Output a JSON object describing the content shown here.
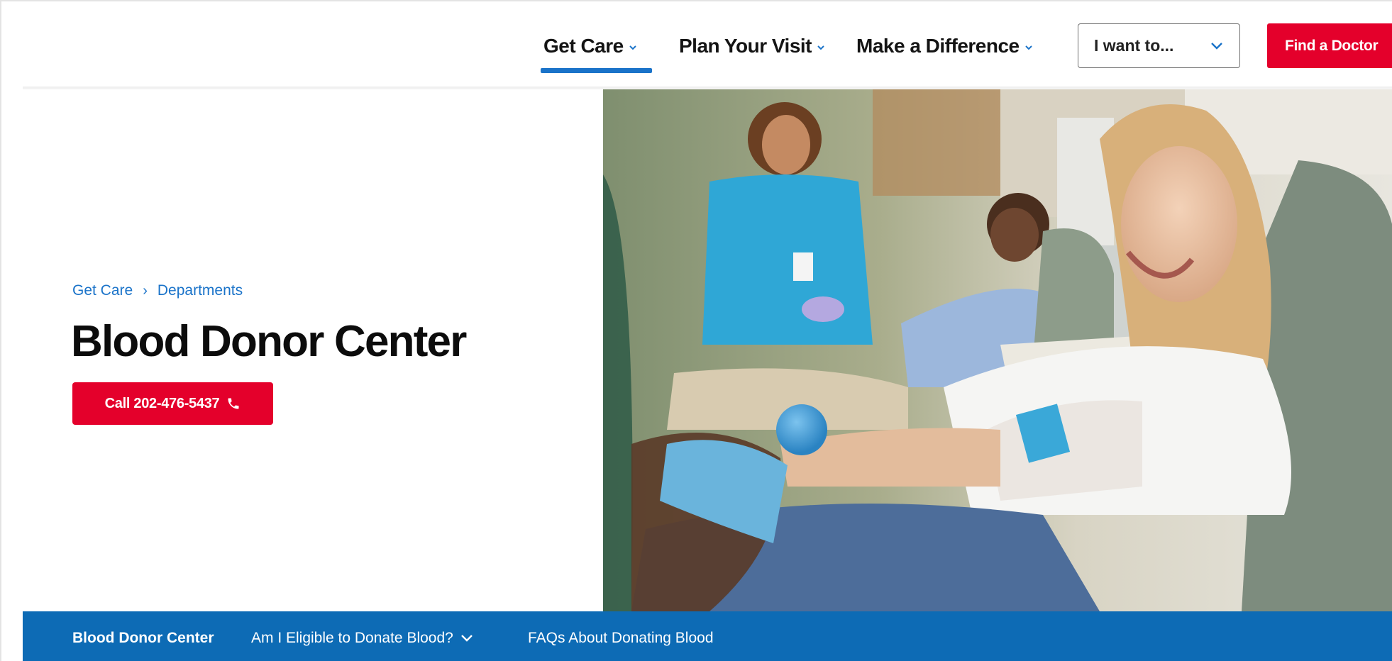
{
  "nav": {
    "items": [
      {
        "label": "Get Care"
      },
      {
        "label": "Plan Your Visit"
      },
      {
        "label": "Make a Difference"
      }
    ],
    "i_want_to": "I want to...",
    "find_doctor": "Find a Doctor"
  },
  "hero": {
    "breadcrumb": [
      "Get Care",
      "Departments"
    ],
    "title": "Blood Donor Center",
    "call_label": "Call 202-476-5437",
    "image_icon": "photo-blood-donation"
  },
  "subnav": {
    "items": [
      {
        "label": "Blood Donor Center"
      },
      {
        "label": "Am I Eligible to Donate Blood?"
      },
      {
        "label": "FAQs About Donating Blood"
      }
    ]
  },
  "colors": {
    "brand_red": "#e4002b",
    "brand_blue": "#0d6bb5",
    "link_blue": "#1a73c9"
  }
}
